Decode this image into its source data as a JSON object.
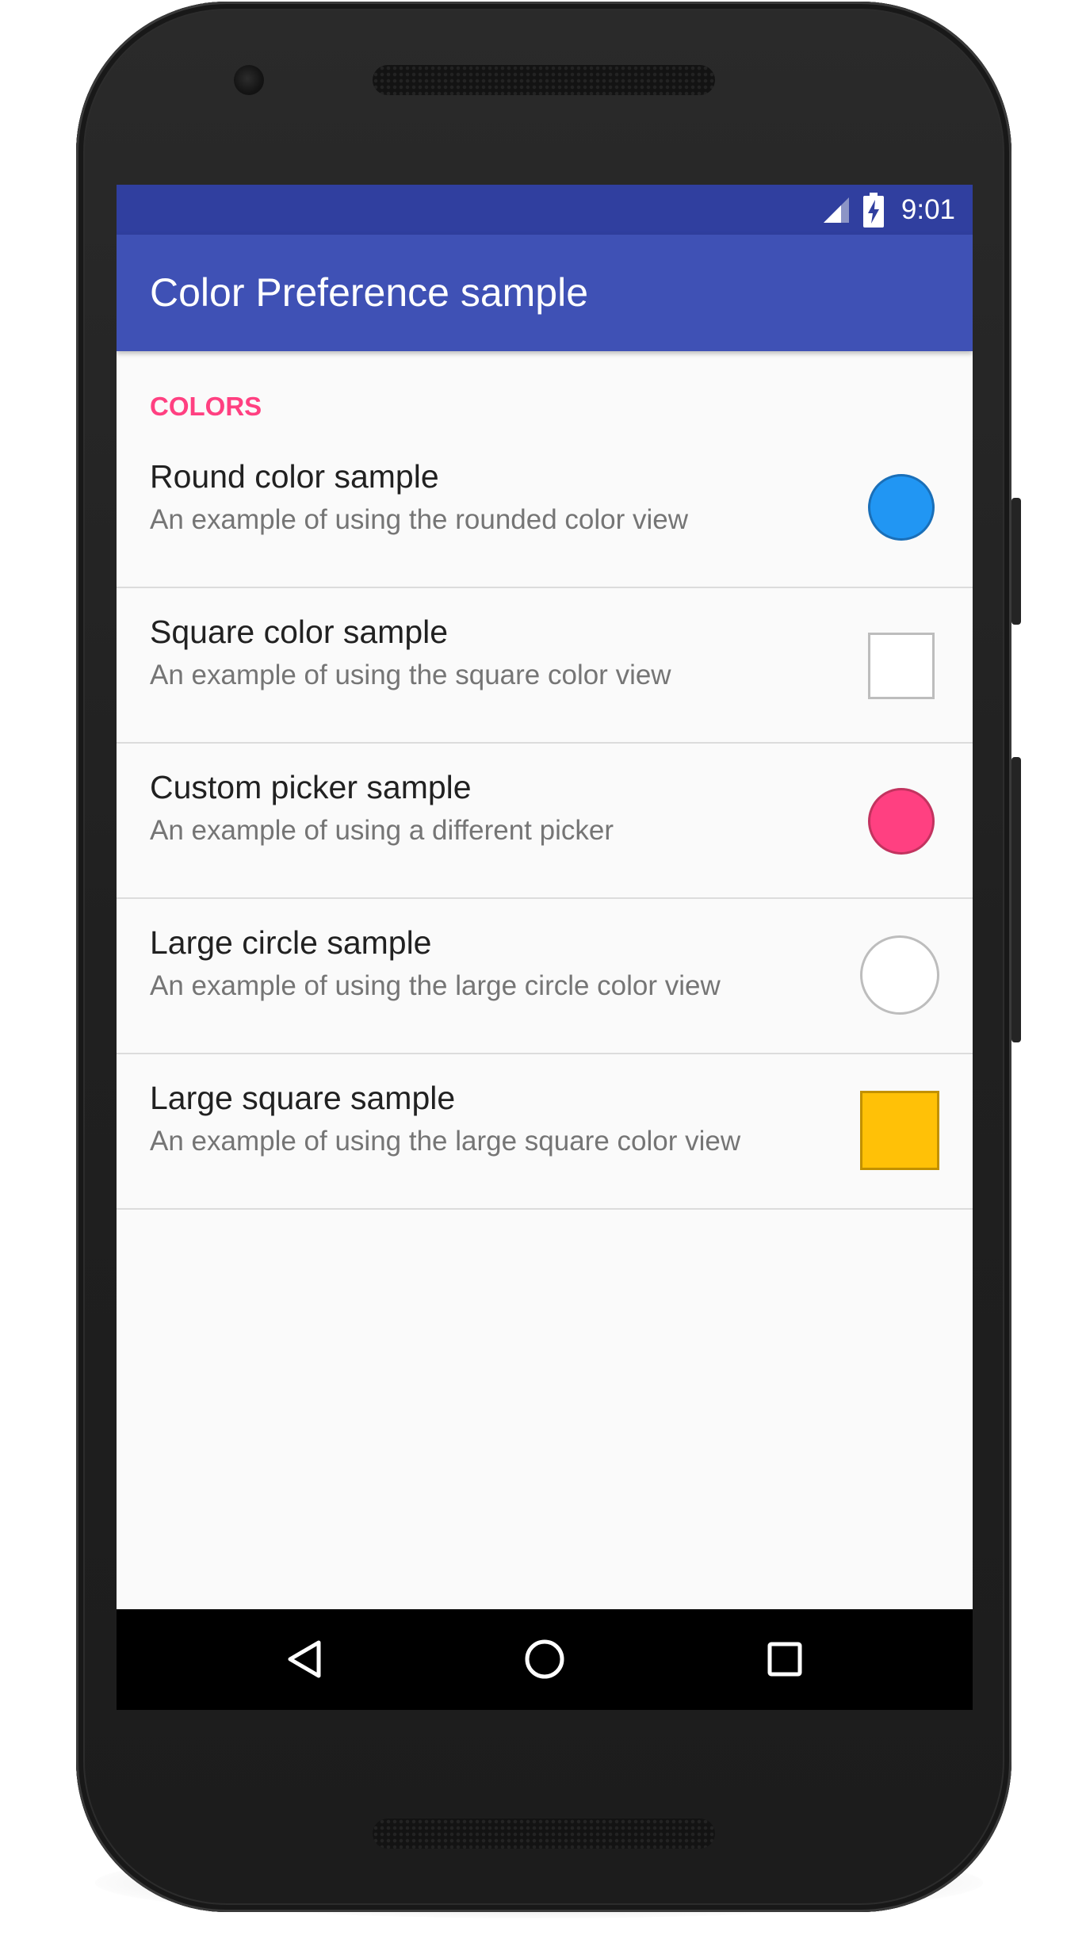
{
  "status_bar": {
    "time": "9:01",
    "icons": [
      "signal-icon",
      "battery-charging-icon"
    ]
  },
  "app_bar": {
    "title": "Color Preference sample"
  },
  "preferences": {
    "category": "COLORS",
    "items": [
      {
        "title": "Round color sample",
        "summary": "An example of using the rounded color view",
        "swatch_shape": "circle",
        "swatch_color": "#2196f3"
      },
      {
        "title": "Square color sample",
        "summary": "An example of using the square color view",
        "swatch_shape": "square",
        "swatch_color": "#ffffff"
      },
      {
        "title": "Custom picker sample",
        "summary": "An example of using a different picker",
        "swatch_shape": "circle",
        "swatch_color": "#ff4081"
      },
      {
        "title": "Large circle sample",
        "summary": "An example of using the large circle color view",
        "swatch_shape": "large-circle",
        "swatch_color": "#ffffff"
      },
      {
        "title": "Large square sample",
        "summary": "An example of using the large square color view",
        "swatch_shape": "large-square",
        "swatch_color": "#ffc107"
      }
    ]
  },
  "nav_bar": {
    "buttons": [
      "back-icon",
      "home-icon",
      "recents-icon"
    ]
  },
  "colors": {
    "status_bar": "#303f9f",
    "app_bar": "#3f51b5",
    "accent": "#ff4081",
    "background": "#fafafa"
  }
}
